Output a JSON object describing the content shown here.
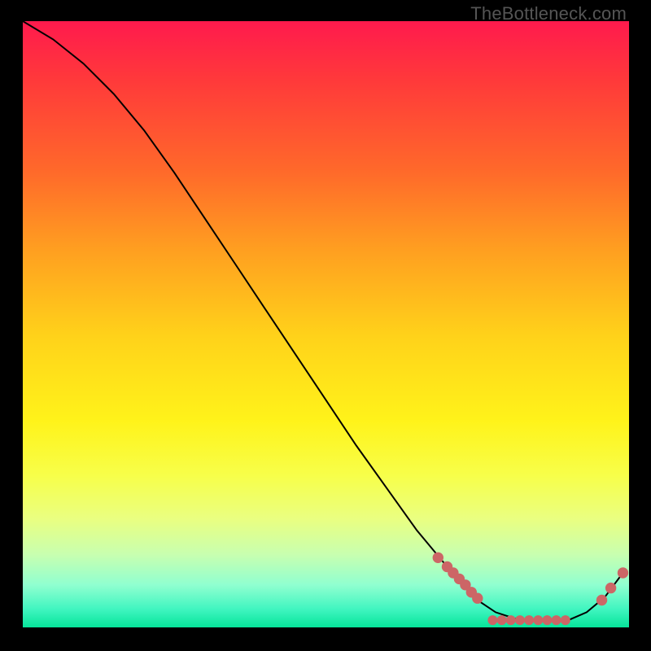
{
  "attribution": "TheBottleneck.com",
  "chart_data": {
    "type": "line",
    "title": "",
    "xlabel": "",
    "ylabel": "",
    "xlim": [
      0,
      100
    ],
    "ylim": [
      0,
      100
    ],
    "series": [
      {
        "name": "curve",
        "x": [
          0,
          5,
          10,
          15,
          20,
          25,
          30,
          35,
          40,
          45,
          50,
          55,
          60,
          65,
          70,
          72,
          75,
          78,
          82,
          86,
          90,
          93,
          96,
          99
        ],
        "y": [
          100,
          97,
          93,
          88,
          82,
          75,
          67.5,
          60,
          52.5,
          45,
          37.5,
          30,
          23,
          16,
          10,
          8,
          4.5,
          2.5,
          1.2,
          1.2,
          1.2,
          2.5,
          5,
          9
        ]
      }
    ],
    "markers": {
      "name": "highlight-dots",
      "color": "#cc6666",
      "points": [
        {
          "x": 68.5,
          "y": 11.5,
          "r": 1.0
        },
        {
          "x": 70.0,
          "y": 10.0,
          "r": 1.0
        },
        {
          "x": 71.0,
          "y": 9.0,
          "r": 1.0
        },
        {
          "x": 72.0,
          "y": 8.0,
          "r": 1.0
        },
        {
          "x": 73.0,
          "y": 7.0,
          "r": 1.0
        },
        {
          "x": 74.0,
          "y": 5.8,
          "r": 1.0
        },
        {
          "x": 75.0,
          "y": 4.8,
          "r": 1.0
        },
        {
          "x": 77.5,
          "y": 1.2,
          "r": 0.9
        },
        {
          "x": 79.0,
          "y": 1.2,
          "r": 0.9
        },
        {
          "x": 80.5,
          "y": 1.2,
          "r": 0.9
        },
        {
          "x": 82.0,
          "y": 1.2,
          "r": 0.9
        },
        {
          "x": 83.5,
          "y": 1.2,
          "r": 0.9
        },
        {
          "x": 85.0,
          "y": 1.2,
          "r": 0.9
        },
        {
          "x": 86.5,
          "y": 1.2,
          "r": 0.9
        },
        {
          "x": 88.0,
          "y": 1.2,
          "r": 0.9
        },
        {
          "x": 89.5,
          "y": 1.2,
          "r": 0.9
        },
        {
          "x": 95.5,
          "y": 4.5,
          "r": 1.0
        },
        {
          "x": 97.0,
          "y": 6.5,
          "r": 1.0
        },
        {
          "x": 99.0,
          "y": 9.0,
          "r": 1.0
        }
      ]
    }
  }
}
